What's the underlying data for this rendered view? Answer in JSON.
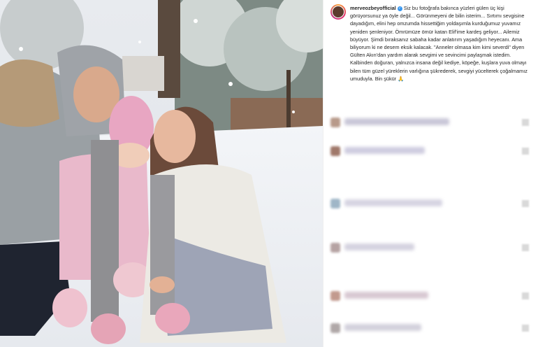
{
  "post": {
    "username": "merveozbeyofficial",
    "caption": "Siz bu fotoğrafa bakınca yüzleri gülen üç kişi görüyorsunuz ya öyle değil... Görünmeyeni de bilin isterim... Sırtımı sevgisine dayadığım, elini hep omzumda hissettiğim yoldaşımla kurduğumuz yuvamız yeniden şenleniyor. Ömrümüze ömür katan Elif'ime kardeş geliyor... Ailemiz büyüyor. Şimdi bıraksanız sabaha kadar anlatırım yaşadığım heyecanı. Ama biliyorum ki ne desem eksik kalacak. \"Anneler olmasa kim kimi severdi\" diyen Gülten Akın'dan yardım alarak sevgimi ve sevincimi paylaşmak istedim. Kalbinden doğuran, yalnızca insana değil kediye, köpeğe, kuşlara yuva olmayı bilen tüm güzel yüreklerin varlığına şükrederek, sevgiyi yücelterek çoğalmamız umuduyla. Bin şükür 🙏",
    "verified_mark": "✓"
  },
  "comments": [
    {
      "avatar_color": "#b89a8a",
      "bar_color": "#c9c7d8"
    },
    {
      "avatar_color": "#a0786a",
      "bar_color": "#cfcde0"
    },
    {
      "avatar_color": "#9fb6c7",
      "bar_color": "#d6d4e2"
    },
    {
      "avatar_color": "#b6a3a3",
      "bar_color": "#d5d3e0"
    },
    {
      "avatar_color": "#c29a8e",
      "bar_color": "#d8c8d2"
    },
    {
      "avatar_color": "#b0a8a8",
      "bar_color": "#d3d1dc"
    }
  ]
}
